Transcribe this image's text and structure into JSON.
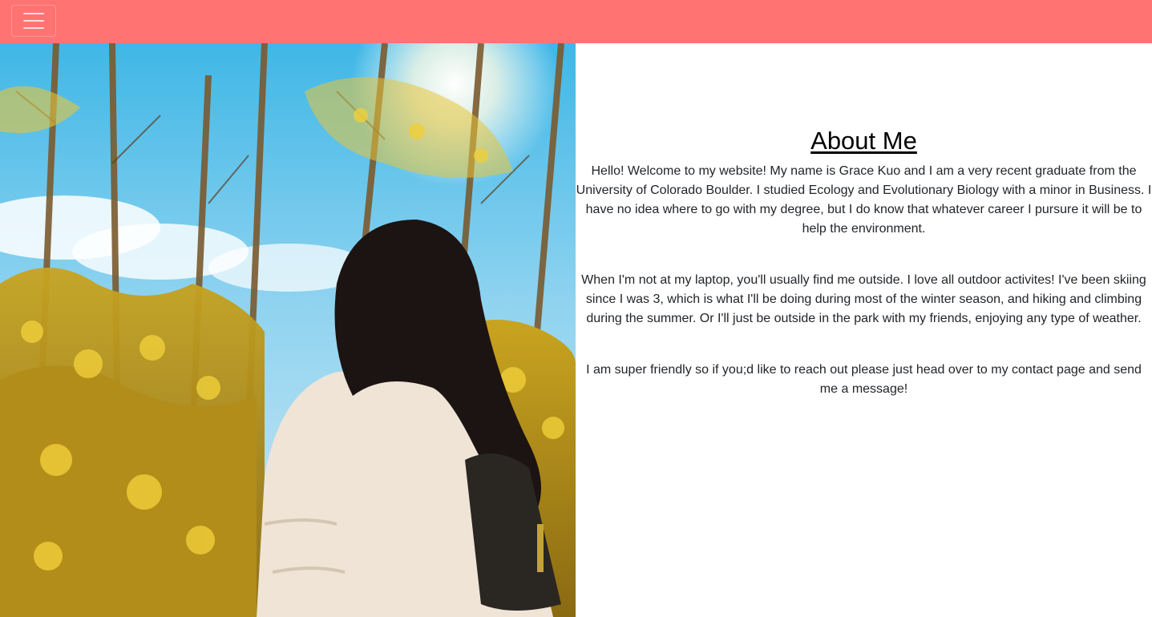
{
  "navbar": {
    "background": "#ff7373",
    "toggle_icon": "hamburger-menu-icon"
  },
  "hero_image": {
    "subject": "photo"
  },
  "about": {
    "heading": "About Me",
    "paragraphs": [
      "Hello! Welcome to my website! My name is Grace Kuo and I am a very recent graduate from the University of Colorado Boulder. I studied Ecology and Evolutionary Biology with a minor in Business. I have no idea where to go with my degree, but I do know that whatever career I pursure it will be to help the environment.",
      "When I'm not at my laptop, you'll usually find me outside. I love all outdoor activites! I've been skiing since I was 3, which is what I'll be doing during most of the winter season, and hiking and climbing during the summer. Or I'll just be outside in the park with my friends, enjoying any type of weather.",
      "I am super friendly so if you;d like to reach out please just head over to my contact page and send me a message!"
    ]
  }
}
